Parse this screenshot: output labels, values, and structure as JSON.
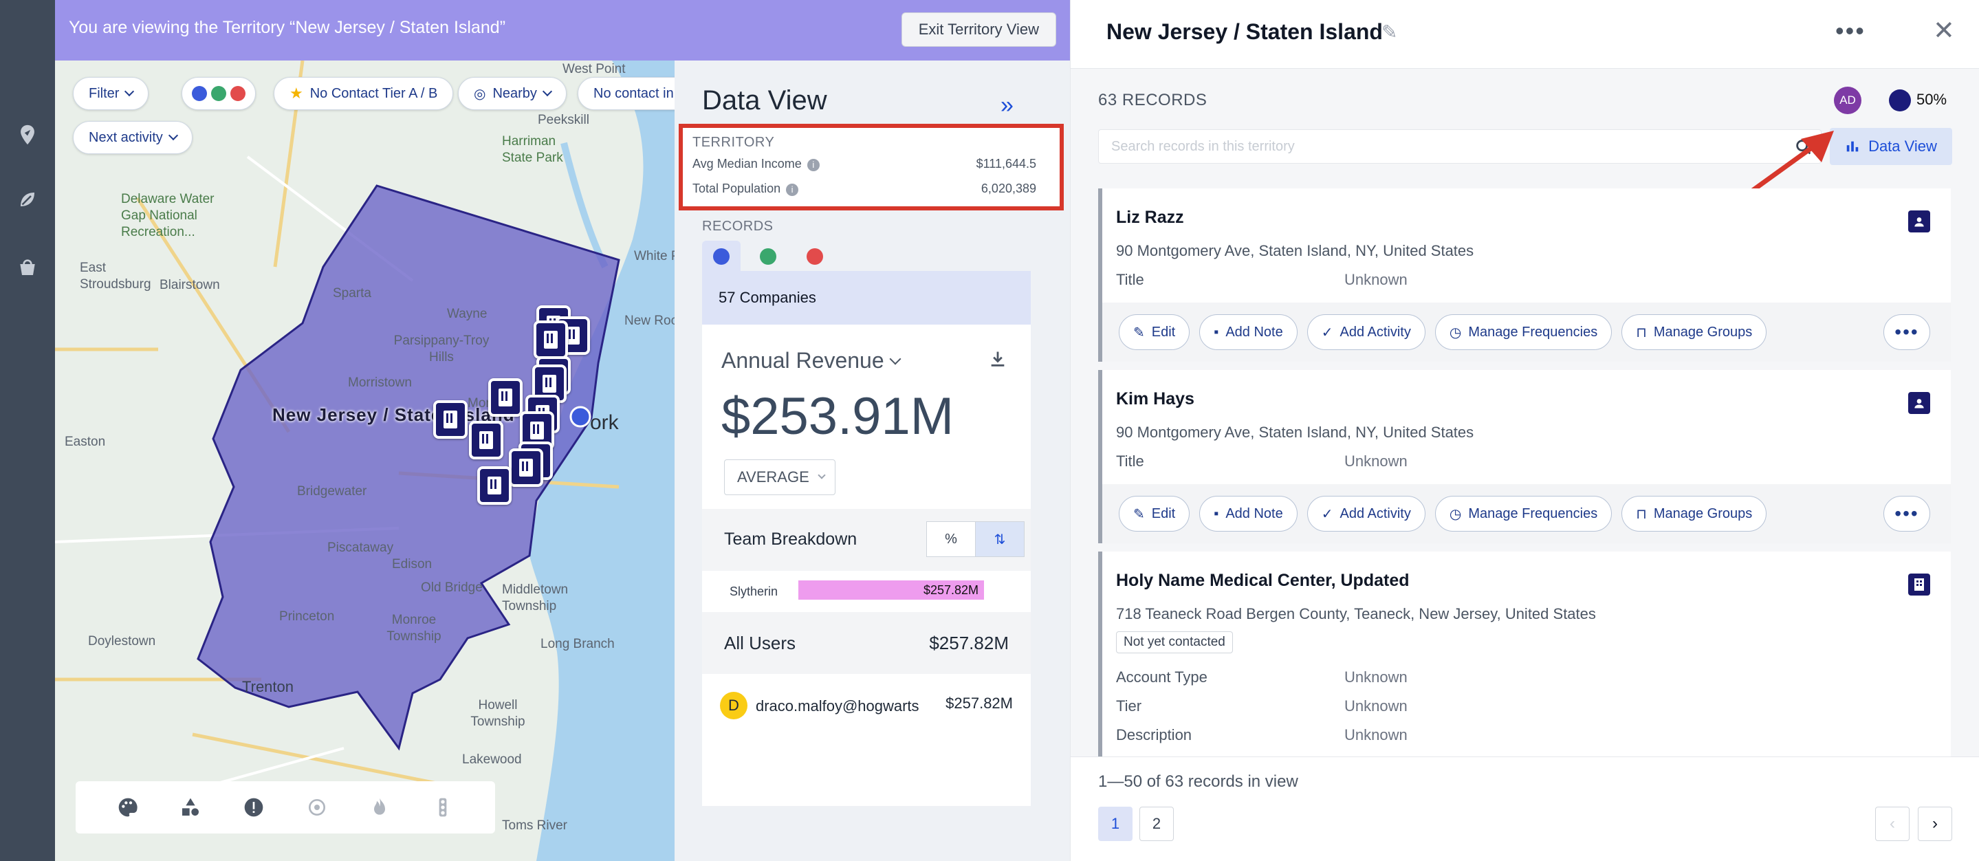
{
  "banner": {
    "text": "You are viewing the Territory “New Jersey / Staten Island”",
    "exit_label": "Exit Territory View"
  },
  "rail": {
    "icons": [
      "map-pin-icon",
      "leaf-route-icon",
      "basket-icon"
    ]
  },
  "map": {
    "filters": [
      {
        "label": "Filter"
      },
      {
        "label": "No Contact Tier A / B"
      },
      {
        "label": "Nearby"
      },
      {
        "label": "No contact in"
      },
      {
        "label": "Next activity"
      }
    ],
    "territory_label": "New Jersey / Staten Island",
    "place_labels": [
      "West Point",
      "Peekskill",
      "Harriman State Park",
      "Delaware Water Gap National Recreation...",
      "East Stroudsburg",
      "Blairstown",
      "Sparta",
      "Wayne",
      "Parsippany-Troy Hills",
      "Morristown",
      "Montclair",
      "Easton",
      "Bridgewater",
      "Piscataway",
      "Edison",
      "Old Bridge",
      "Middletown Township",
      "Princeton",
      "Monroe Township",
      "Doylestown",
      "Trenton",
      "Howell Township",
      "Long Branch",
      "Lakewood",
      "Toms River",
      "White Pl",
      "New Roc",
      "ork"
    ],
    "colors": {
      "territory_fill": "#6a63c8",
      "marker": "#1a1a6b"
    }
  },
  "data_view": {
    "title": "Data View",
    "territory_heading": "TERRITORY",
    "stats": [
      {
        "label": "Avg Median Income",
        "value": "$111,644.5"
      },
      {
        "label": "Total Population",
        "value": "6,020,389"
      }
    ],
    "records_heading": "RECORDS",
    "companies_label": "57 Companies",
    "metric_label": "Annual Revenue",
    "metric_value": "$253.91M",
    "aggregation": "AVERAGE",
    "team_breakdown_label": "Team Breakdown",
    "toggles": [
      "%",
      "⇅"
    ],
    "teams": [
      {
        "name": "Slytherin",
        "value": "$257.82M",
        "share": 0.88
      }
    ],
    "all_users_label": "All Users",
    "all_users_value": "$257.82M",
    "users": [
      {
        "initial": "D",
        "email": "draco.malfoy@hogwarts",
        "value": "$257.82M"
      }
    ]
  },
  "panel": {
    "title": "New Jersey / Staten Island",
    "record_count": "63 RECORDS",
    "owner_initials": "AD",
    "percent": "50%",
    "search_placeholder": "Search records in this territory",
    "data_view_button": "Data View",
    "actions": [
      "Edit",
      "Add Note",
      "Add Activity",
      "Manage Frequencies",
      "Manage Groups"
    ],
    "records": [
      {
        "name": "Liz Razz",
        "address": "90 Montgomery Ave, Staten Island, NY, United States",
        "fields": [
          {
            "label": "Title",
            "value": "Unknown"
          }
        ],
        "type": "person"
      },
      {
        "name": "Kim Hays",
        "address": "90 Montgomery Ave, Staten Island, NY, United States",
        "fields": [
          {
            "label": "Title",
            "value": "Unknown"
          }
        ],
        "type": "person"
      },
      {
        "name": "Holy Name Medical Center, Updated",
        "address": "718 Teaneck Road Bergen County, Teaneck, New Jersey, United States",
        "tag": "Not yet contacted",
        "fields": [
          {
            "label": "Account Type",
            "value": "Unknown"
          },
          {
            "label": "Tier",
            "value": "Unknown"
          },
          {
            "label": "Description",
            "value": "Unknown"
          }
        ],
        "type": "company"
      }
    ],
    "range_text": "1—50 of 63 records in view",
    "pages": [
      "1",
      "2"
    ]
  }
}
